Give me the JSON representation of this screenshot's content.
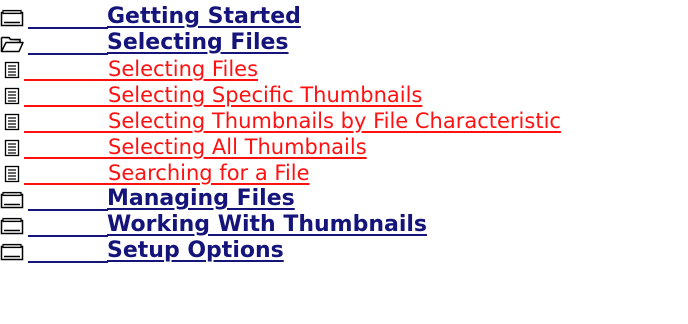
{
  "toc": {
    "items": [
      {
        "type": "book",
        "state": "closed",
        "icon": "closed-book-icon",
        "label": "Getting Started"
      },
      {
        "type": "book",
        "state": "open",
        "icon": "open-book-icon",
        "label": "Selecting Files"
      },
      {
        "type": "topic",
        "icon": "topic-page-icon",
        "label": "Selecting Files"
      },
      {
        "type": "topic",
        "icon": "topic-page-icon",
        "label": "Selecting Specific Thumbnails"
      },
      {
        "type": "topic",
        "icon": "topic-page-icon",
        "label": "Selecting Thumbnails by File Characteristic"
      },
      {
        "type": "topic",
        "icon": "topic-page-icon",
        "label": "Selecting All Thumbnails"
      },
      {
        "type": "topic",
        "icon": "topic-page-icon",
        "label": "Searching for a File"
      },
      {
        "type": "book",
        "state": "closed",
        "icon": "closed-book-icon",
        "label": "Managing Files"
      },
      {
        "type": "book",
        "state": "closed",
        "icon": "closed-book-icon",
        "label": "Working With Thumbnails"
      },
      {
        "type": "book",
        "state": "closed",
        "icon": "closed-book-icon",
        "label": "Setup Options"
      }
    ]
  },
  "colors": {
    "book_link": "#14147a",
    "topic_link": "#ff1111"
  }
}
